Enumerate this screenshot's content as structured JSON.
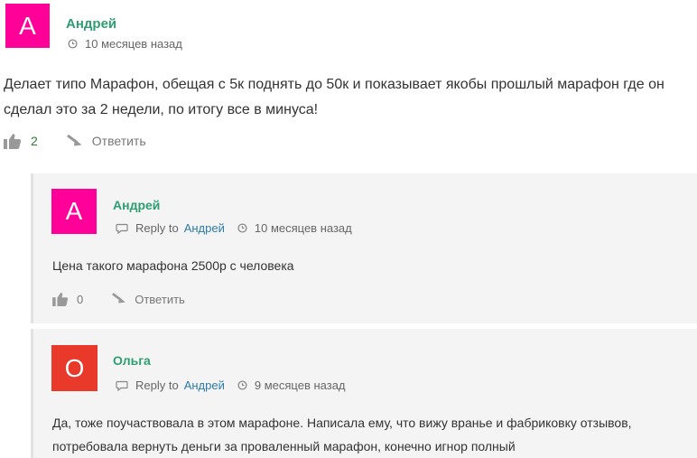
{
  "comments": [
    {
      "avatar_letter": "А",
      "avatar_color": "#ff0099",
      "author": "Андрей",
      "time": "10 месяцев назад",
      "text": "Делает типо Марафон, обещая с 5к поднять до 50к и показывает якобы прошлый марафон где он сделал это за 2 недели, по итогу все в минуса!",
      "likes": "2",
      "reply_label": "Ответить"
    },
    {
      "avatar_letter": "А",
      "avatar_color": "#ff0099",
      "author": "Андрей",
      "reply_to_prefix": "Reply to",
      "reply_to": "Андрей",
      "time": "10 месяцев назад",
      "text": "Цена такого марафона 2500р с человека",
      "likes": "0",
      "reply_label": "Ответить"
    },
    {
      "avatar_letter": "О",
      "avatar_color": "#e8392a",
      "author": "Ольга",
      "reply_to_prefix": "Reply to",
      "reply_to": "Андрей",
      "time": "9 месяцев назад",
      "text": "Да, тоже поучаствовала в этом марафоне. Написала ему, что вижу вранье и фабриковку отзывов, потребовала вернуть деньги за проваленный марафон, конечно игнор полный"
    }
  ],
  "colors": {
    "author": "#2e9e72",
    "link": "#2d7aa8",
    "likes_count": "#2e7d32",
    "reply_background": "#f4f4f4"
  }
}
